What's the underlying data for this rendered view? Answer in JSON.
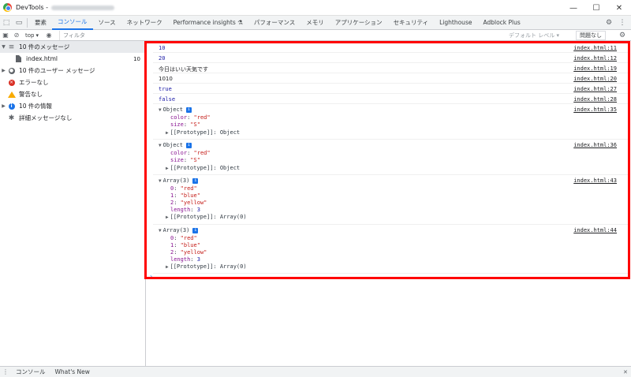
{
  "window": {
    "title": "DevTools -",
    "minimize": "—",
    "maximize": "☐",
    "close": "✕"
  },
  "tabs": [
    "要素",
    "コンソール",
    "ソース",
    "ネットワーク",
    "Performance insights ⚗",
    "パフォーマンス",
    "メモリ",
    "アプリケーション",
    "セキュリティ",
    "Lighthouse",
    "Adblock Plus"
  ],
  "tabbar_icons": {
    "inspect": "⬚",
    "device": "▭",
    "settings": "⚙",
    "more": "⋮"
  },
  "toolbar": {
    "context": "top",
    "filter_placeholder": "フィルタ",
    "levels": "デフォルト レベル ▾",
    "issues": "問題なし"
  },
  "sidebar": {
    "items": [
      {
        "label": "10 件のメッセージ",
        "count": "",
        "icon": "list-icon"
      },
      {
        "label": "index.html",
        "count": "10",
        "icon": "file-icon"
      },
      {
        "label": "10 件のユーザー メッセージ",
        "count": "",
        "icon": "user-icon"
      },
      {
        "label": "エラーなし",
        "count": "",
        "icon": "error-icon"
      },
      {
        "label": "警告なし",
        "count": "",
        "icon": "warning-icon"
      },
      {
        "label": "10 件の情報",
        "count": "",
        "icon": "info-icon"
      },
      {
        "label": "詳細メッセージなし",
        "count": "",
        "icon": "verbose-icon"
      }
    ]
  },
  "console": {
    "simple": [
      {
        "text": "10",
        "src": "index.html:11"
      },
      {
        "text": "20",
        "src": "index.html:12"
      },
      {
        "text": "今日はいい天気です",
        "src": "index.html:19"
      },
      {
        "text": "1010",
        "src": "index.html:20"
      },
      {
        "text": "true",
        "src": "index.html:27"
      },
      {
        "text": "false",
        "src": "index.html:28"
      }
    ],
    "objects": [
      {
        "header": "Object",
        "src": "index.html:35",
        "k1": "color",
        "v1": "\"red\"",
        "k2": "size",
        "v2": "\"S\"",
        "proto": "[[Prototype]]: Object"
      },
      {
        "header": "Object",
        "src": "index.html:36",
        "k1": "color",
        "v1": "\"red\"",
        "k2": "size",
        "v2": "\"S\"",
        "proto": "[[Prototype]]: Object"
      }
    ],
    "arrays": [
      {
        "header": "Array(3)",
        "src": "index.html:43",
        "i0": "0",
        "v0": "\"red\"",
        "i1": "1",
        "v1": "\"blue\"",
        "i2": "2",
        "v2": "\"yellow\"",
        "lenk": "length",
        "lenv": "3",
        "proto": "[[Prototype]]: Array(0)"
      },
      {
        "header": "Array(3)",
        "src": "index.html:44",
        "i0": "0",
        "v0": "\"red\"",
        "i1": "1",
        "v1": "\"blue\"",
        "i2": "2",
        "v2": "\"yellow\"",
        "lenk": "length",
        "lenv": "3",
        "proto": "[[Prototype]]: Array(0)"
      }
    ],
    "info_badge": "i",
    "prompt": "›"
  },
  "drawer": {
    "tabs": [
      "コンソール",
      "What's New"
    ],
    "close": "✕"
  }
}
